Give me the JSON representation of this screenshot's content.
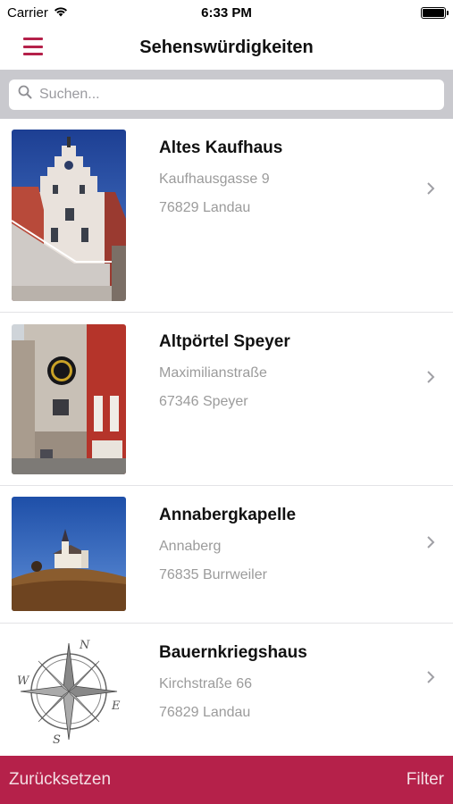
{
  "status_bar": {
    "carrier": "Carrier",
    "time": "6:33 PM",
    "battery_level": 1.0
  },
  "nav": {
    "title": "Sehenswürdigkeiten",
    "menu_icon": "hamburger-menu-icon"
  },
  "search": {
    "placeholder": "Suchen...",
    "value": ""
  },
  "items": [
    {
      "title": "Altes Kaufhaus",
      "street": "Kaufhausgasse 9",
      "city": "76829 Landau",
      "image": "building-photo"
    },
    {
      "title": "Altpörtel Speyer",
      "street": "Maximilianstraße",
      "city": "67346 Speyer",
      "image": "clock-tower-photo"
    },
    {
      "title": "Annabergkapelle",
      "street": "Annaberg",
      "city": "76835 Burrweiler",
      "image": "chapel-photo"
    },
    {
      "title": "Bauernkriegshaus",
      "street": "Kirchstraße 66",
      "city": "76829 Landau",
      "image": "compass-rose-icon"
    }
  ],
  "bottom_bar": {
    "reset_label": "Zurücksetzen",
    "filter_label": "Filter"
  },
  "colors": {
    "accent": "#b5214a",
    "search_bar_bg": "#c9c9ce",
    "subtitle_text": "#9b9b9b"
  }
}
